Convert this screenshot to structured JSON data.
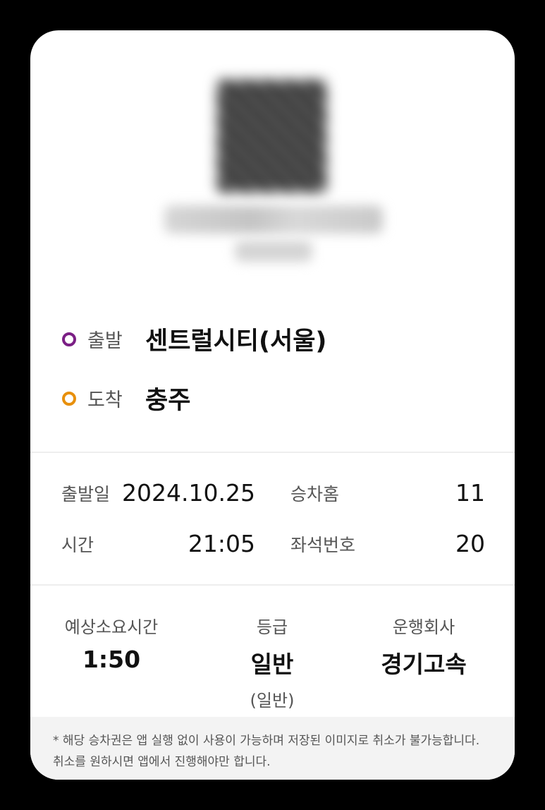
{
  "route": {
    "departure_label": "출발",
    "departure_value": "센트럴시티(서울)",
    "departure_color": "#7B1F85",
    "arrival_label": "도착",
    "arrival_value": "충주",
    "arrival_color": "#E8900C"
  },
  "details": {
    "date_label": "출발일",
    "date_value": "2024.10.25",
    "platform_label": "승차홈",
    "platform_value": "11",
    "time_label": "시간",
    "time_value": "21:05",
    "seat_label": "좌석번호",
    "seat_value": "20"
  },
  "info": {
    "duration_label": "예상소요시간",
    "duration_value": "1:50",
    "grade_label": "등급",
    "grade_value": "일반",
    "grade_sub": "(일반)",
    "company_label": "운행회사",
    "company_value": "경기고속"
  },
  "notice": {
    "line1": "* 해당 승차권은 앱 실행 없이 사용이 가능하며 저장된 이미지로 취소가 불가능합니다.",
    "line2": "취소를 원하시면 앱에서 진행해야만 합니다."
  }
}
